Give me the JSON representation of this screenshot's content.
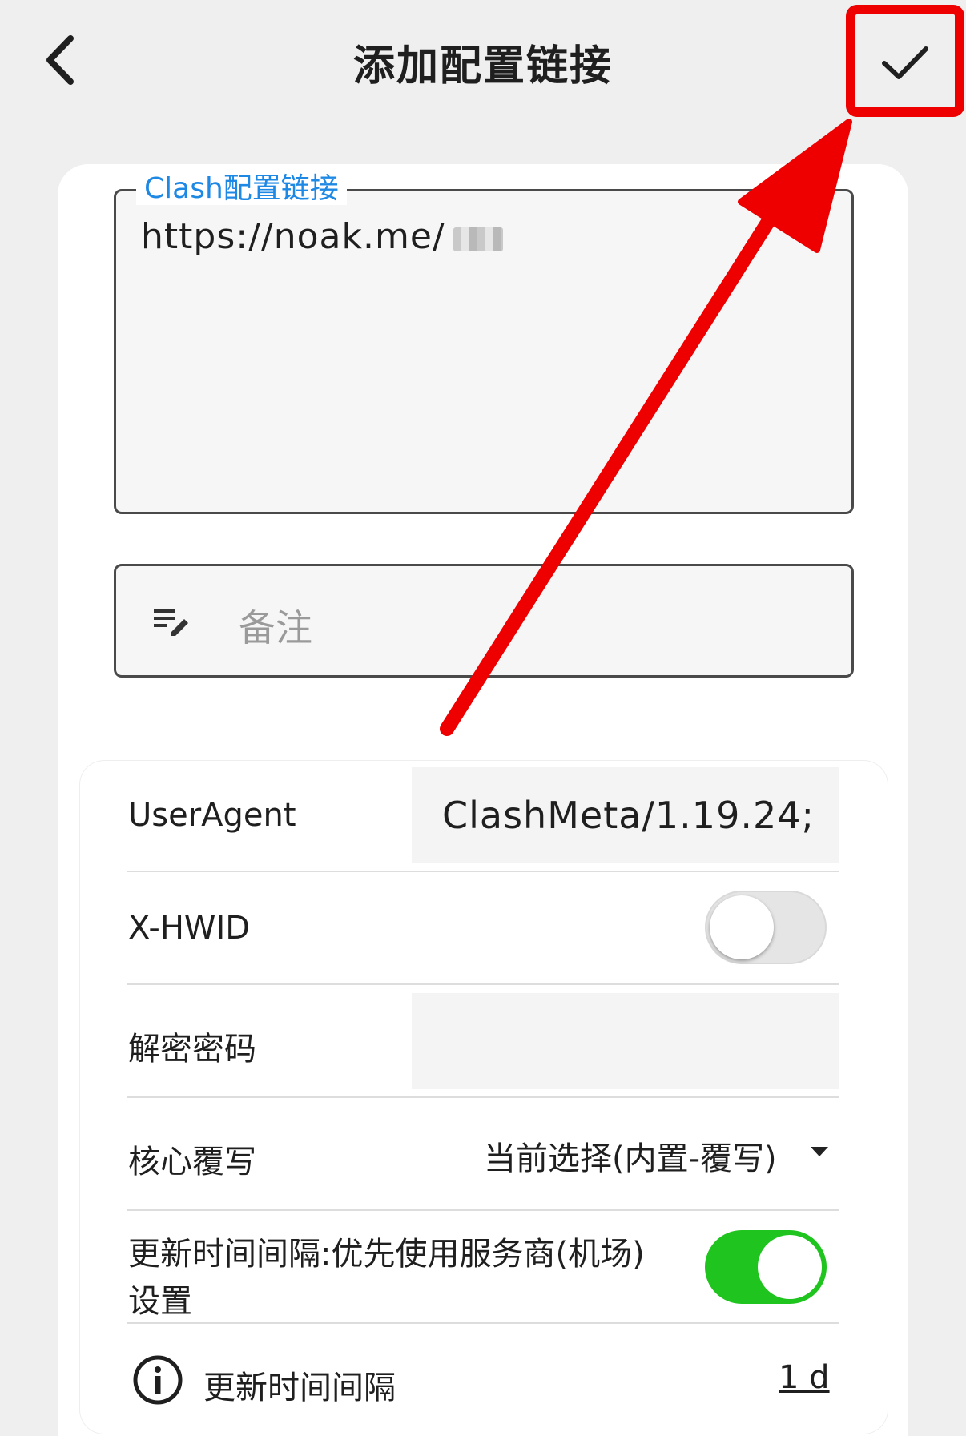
{
  "header": {
    "title": "添加配置链接"
  },
  "url_field": {
    "label": "Clash配置链接",
    "value": "https://noak.me/"
  },
  "note_field": {
    "placeholder": "备注"
  },
  "settings": {
    "user_agent": {
      "label": "UserAgent",
      "value": "ClashMeta/1.19.24;"
    },
    "hwid": {
      "label": "X-HWID",
      "enabled": false
    },
    "decrypt_password": {
      "label": "解密密码",
      "value": ""
    },
    "core_override": {
      "label": "核心覆写",
      "selected": "当前选择(内置-覆写)"
    },
    "provider_interval": {
      "label_line1": "更新时间间隔:优先使用服务商(机场)",
      "label_line2": "设置",
      "enabled": true
    },
    "update_interval": {
      "label": "更新时间间隔",
      "value": "1 d"
    }
  },
  "colors": {
    "accent_blue": "#1e88e5",
    "toggle_on": "#1fc41f",
    "annotation_red": "#ee0000"
  },
  "icons": [
    "back-arrow-icon",
    "checkmark-icon",
    "note-edit-icon",
    "dropdown-caret-icon",
    "info-icon"
  ]
}
